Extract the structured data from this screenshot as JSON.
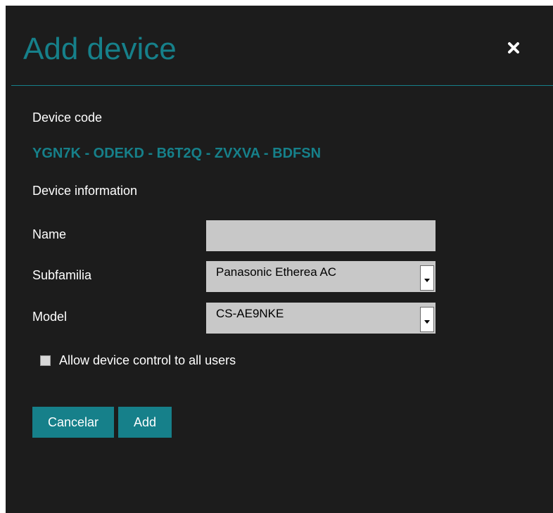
{
  "dialog": {
    "title": "Add device",
    "close_icon": "close-icon"
  },
  "device_code": {
    "label": "Device code",
    "value": "YGN7K - ODEKD - B6T2Q - ZVXVA - BDFSN"
  },
  "device_info": {
    "heading": "Device information"
  },
  "form": {
    "name": {
      "label": "Name",
      "value": ""
    },
    "subfamilia": {
      "label": "Subfamilia",
      "selected": "Panasonic Etherea AC"
    },
    "model": {
      "label": "Model",
      "selected": "CS-AE9NKE"
    },
    "allow_control": {
      "label": "Allow device control to all users",
      "checked": false
    }
  },
  "buttons": {
    "cancel_label": "Cancelar",
    "add_label": "Add"
  },
  "colors": {
    "accent": "#16808a",
    "background": "#1c1c1c",
    "field": "#c8c8c8"
  }
}
